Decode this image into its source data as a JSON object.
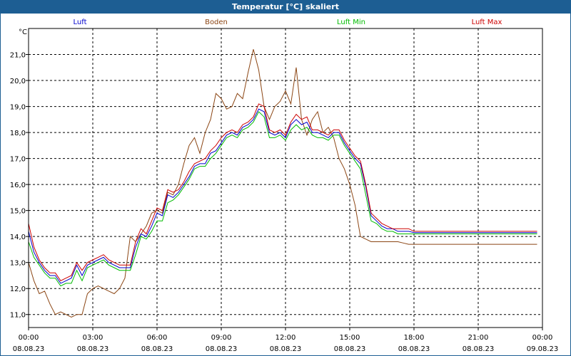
{
  "title": "Temperatur [°C] skaliert",
  "unit_label": "°C",
  "colors": {
    "titlebar": "#1d5e93",
    "luft": "#0000cc",
    "boden": "#8b4513",
    "luft_min": "#00bb00",
    "luft_max": "#cc0000"
  },
  "chart_data": {
    "type": "line",
    "title": "Temperatur [°C] skaliert",
    "ylabel": "°C",
    "xlabel": "",
    "ylim": [
      10.5,
      22.0
    ],
    "xlim": [
      0,
      24
    ],
    "grid": true,
    "legend": "top",
    "x_ticks": [
      {
        "time": "00:00",
        "date": "08.08.23"
      },
      {
        "time": "03:00",
        "date": "08.08.23"
      },
      {
        "time": "06:00",
        "date": "08.08.23"
      },
      {
        "time": "09:00",
        "date": "08.08.23"
      },
      {
        "time": "12:00",
        "date": "08.08.23"
      },
      {
        "time": "15:00",
        "date": "08.08.23"
      },
      {
        "time": "18:00",
        "date": "08.08.23"
      },
      {
        "time": "21:00",
        "date": "08.08.23"
      },
      {
        "time": "00:00",
        "date": "09.08.23"
      }
    ],
    "y_ticks": [
      "11,0",
      "12,0",
      "13,0",
      "14,0",
      "15,0",
      "16,0",
      "17,0",
      "18,0",
      "19,0",
      "20,0",
      "21,0"
    ],
    "x_hours": [
      0,
      0.25,
      0.5,
      0.75,
      1,
      1.25,
      1.5,
      1.75,
      2,
      2.25,
      2.5,
      2.75,
      3,
      3.25,
      3.5,
      3.75,
      4,
      4.25,
      4.5,
      4.75,
      5,
      5.25,
      5.5,
      5.75,
      6,
      6.25,
      6.5,
      6.75,
      7,
      7.25,
      7.5,
      7.75,
      8,
      8.25,
      8.5,
      8.75,
      9,
      9.25,
      9.5,
      9.75,
      10,
      10.25,
      10.5,
      10.75,
      11,
      11.25,
      11.5,
      11.75,
      12,
      12.25,
      12.5,
      12.75,
      13,
      13.25,
      13.5,
      13.75,
      14,
      14.25,
      14.5,
      14.75,
      15,
      15.25,
      15.5,
      15.75,
      16,
      16.25,
      16.5,
      16.75,
      17,
      17.25,
      17.5,
      17.75,
      18,
      18.25,
      18.5,
      18.75,
      19,
      19.25,
      19.5,
      19.75,
      20,
      20.25,
      20.5,
      20.75,
      21,
      21.25,
      21.5,
      21.75,
      22,
      22.25,
      22.5,
      22.75,
      23,
      23.25,
      23.5,
      23.75
    ],
    "series": [
      {
        "name": "Luft",
        "color": "#0000cc",
        "values": [
          14.2,
          13.4,
          13.0,
          12.7,
          12.5,
          12.5,
          12.2,
          12.3,
          12.4,
          12.9,
          12.5,
          12.9,
          13.0,
          13.1,
          13.2,
          13.0,
          12.9,
          12.8,
          12.8,
          12.8,
          13.6,
          14.1,
          14.0,
          14.4,
          14.9,
          14.8,
          15.6,
          15.5,
          15.7,
          16.0,
          16.3,
          16.7,
          16.8,
          16.8,
          17.2,
          17.3,
          17.6,
          17.9,
          18.0,
          17.9,
          18.2,
          18.3,
          18.5,
          18.9,
          18.8,
          18.0,
          17.9,
          18.0,
          17.8,
          18.3,
          18.5,
          18.3,
          18.4,
          18.0,
          18.0,
          17.9,
          17.8,
          18.0,
          18.0,
          17.6,
          17.3,
          17.0,
          16.8,
          15.9,
          14.8,
          14.6,
          14.4,
          14.3,
          14.3,
          14.2,
          14.2,
          14.2,
          14.15,
          14.15,
          14.15,
          14.15,
          14.15,
          14.15,
          14.15,
          14.15,
          14.15,
          14.15,
          14.15,
          14.15,
          14.15,
          14.15,
          14.15,
          14.15,
          14.15,
          14.15,
          14.15,
          14.15,
          14.15,
          14.15,
          14.15,
          14.15
        ]
      },
      {
        "name": "Boden",
        "color": "#8b4513",
        "values": [
          13.0,
          12.3,
          11.8,
          11.9,
          11.4,
          11.0,
          11.1,
          11.0,
          10.9,
          11.0,
          11.0,
          11.8,
          12.0,
          12.1,
          12.0,
          11.9,
          11.8,
          12.0,
          12.4,
          14.0,
          13.8,
          14.1,
          14.4,
          14.9,
          15.0,
          14.9,
          15.7,
          15.6,
          16.0,
          16.8,
          17.5,
          17.8,
          17.2,
          18.0,
          18.5,
          19.5,
          19.3,
          18.9,
          19.0,
          19.5,
          19.3,
          20.3,
          21.2,
          20.4,
          19.0,
          18.5,
          19.0,
          19.2,
          19.6,
          19.1,
          20.5,
          18.5,
          17.9,
          18.5,
          18.8,
          18.0,
          18.2,
          17.8,
          17.0,
          16.6,
          16.0,
          15.2,
          14.0,
          13.9,
          13.8,
          13.8,
          13.8,
          13.8,
          13.8,
          13.8,
          13.75,
          13.7,
          13.7,
          13.7,
          13.7,
          13.7,
          13.7,
          13.7,
          13.7,
          13.7,
          13.7,
          13.7,
          13.7,
          13.7,
          13.7,
          13.7,
          13.7,
          13.7,
          13.7,
          13.7,
          13.7,
          13.7,
          13.7,
          13.7,
          13.7,
          13.7
        ]
      },
      {
        "name": "Luft Min",
        "color": "#00bb00",
        "values": [
          13.8,
          13.2,
          12.9,
          12.6,
          12.4,
          12.4,
          12.1,
          12.2,
          12.2,
          12.7,
          12.3,
          12.8,
          12.9,
          13.0,
          13.1,
          12.9,
          12.8,
          12.7,
          12.7,
          12.7,
          13.3,
          14.0,
          13.9,
          14.2,
          14.6,
          14.6,
          15.3,
          15.4,
          15.6,
          15.9,
          16.2,
          16.6,
          16.7,
          16.7,
          17.0,
          17.2,
          17.5,
          17.8,
          17.9,
          17.8,
          18.1,
          18.2,
          18.4,
          18.8,
          18.6,
          17.8,
          17.8,
          17.9,
          17.7,
          18.1,
          18.3,
          18.1,
          18.2,
          17.9,
          17.8,
          17.8,
          17.7,
          17.9,
          17.9,
          17.5,
          17.2,
          16.9,
          16.6,
          15.6,
          14.6,
          14.5,
          14.3,
          14.2,
          14.2,
          14.1,
          14.1,
          14.1,
          14.1,
          14.1,
          14.1,
          14.1,
          14.1,
          14.1,
          14.1,
          14.1,
          14.1,
          14.1,
          14.1,
          14.1,
          14.1,
          14.1,
          14.1,
          14.1,
          14.1,
          14.1,
          14.1,
          14.1,
          14.1,
          14.1,
          14.1,
          14.1
        ]
      },
      {
        "name": "Luft Max",
        "color": "#cc0000",
        "values": [
          14.5,
          13.6,
          13.1,
          12.8,
          12.6,
          12.6,
          12.3,
          12.4,
          12.5,
          13.0,
          12.7,
          13.0,
          13.1,
          13.2,
          13.3,
          13.1,
          13.0,
          12.9,
          12.9,
          12.9,
          13.8,
          14.3,
          14.1,
          14.6,
          15.1,
          15.0,
          15.8,
          15.7,
          15.8,
          16.1,
          16.5,
          16.8,
          16.9,
          17.0,
          17.3,
          17.5,
          17.8,
          18.0,
          18.1,
          18.0,
          18.3,
          18.4,
          18.6,
          19.1,
          19.0,
          18.1,
          18.0,
          18.1,
          17.9,
          18.4,
          18.7,
          18.5,
          18.6,
          18.1,
          18.1,
          18.0,
          17.9,
          18.1,
          18.1,
          17.7,
          17.4,
          17.1,
          16.9,
          16.0,
          14.9,
          14.7,
          14.5,
          14.4,
          14.3,
          14.3,
          14.3,
          14.3,
          14.2,
          14.2,
          14.2,
          14.2,
          14.2,
          14.2,
          14.2,
          14.2,
          14.2,
          14.2,
          14.2,
          14.2,
          14.2,
          14.2,
          14.2,
          14.2,
          14.2,
          14.2,
          14.2,
          14.2,
          14.2,
          14.2,
          14.2,
          14.2
        ]
      }
    ]
  }
}
